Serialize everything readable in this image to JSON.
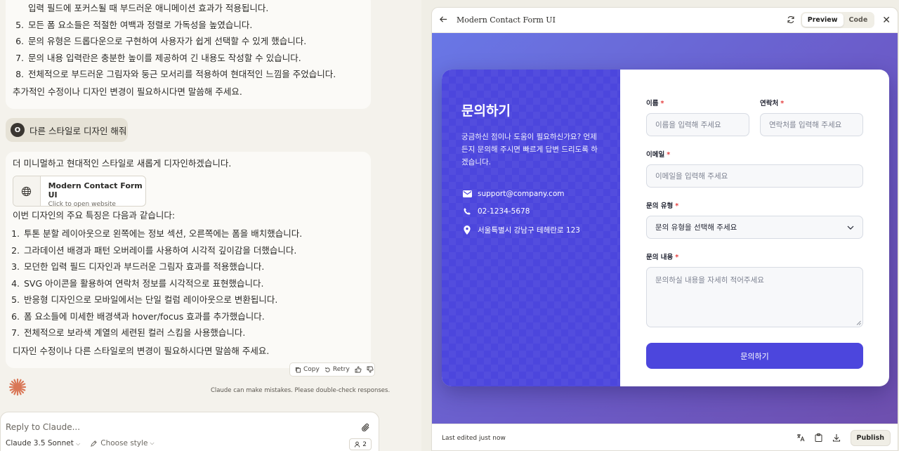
{
  "chat": {
    "top_list": [
      {
        "num": "",
        "text": "입력 필드에 포커스될 때 부드러운 애니메이션 효과가 적용됩니다."
      },
      {
        "num": "5.",
        "text": "모든 폼 요소들은 적절한 여백과 정렬로 가독성을 높였습니다."
      },
      {
        "num": "6.",
        "text": "문의 유형은 드롭다운으로 구현하여 사용자가 쉽게 선택할 수 있게 했습니다."
      },
      {
        "num": "7.",
        "text": "문의 내용 입력란은 충분한 높이를 제공하여 긴 내용도 작성할 수 있습니다."
      },
      {
        "num": "8.",
        "text": "전체적으로 부드러운 그림자와 둥근 모서리를 적용하여 현대적인 느낌을 주었습니다."
      }
    ],
    "top_closing": "추가적인 수정이나 디자인 변경이 필요하시다면 말씀해 주세요.",
    "user_initial": "O",
    "user_message": "다른 스타일로 디자인 해줘",
    "reply_intro": "더 미니멀하고 현대적인 스타일로 새롭게 디자인하겠습니다.",
    "artifact_title": "Modern Contact Form UI",
    "artifact_sub": "Click to open website",
    "features_intro": "이번 디자인의 주요 특징은 다음과 같습니다:",
    "features": [
      {
        "num": "1.",
        "text": "투톤 분할 레이아웃으로 왼쪽에는 정보 섹션, 오른쪽에는 폼을 배치했습니다."
      },
      {
        "num": "2.",
        "text": "그라데이션 배경과 패턴 오버레이를 사용하여 시각적 깊이감을 더했습니다."
      },
      {
        "num": "3.",
        "text": "모던한 입력 필드 디자인과 부드러운 그림자 효과를 적용했습니다."
      },
      {
        "num": "4.",
        "text": "SVG 아이콘을 활용하여 연락처 정보를 시각적으로 표현했습니다."
      },
      {
        "num": "5.",
        "text": "반응형 디자인으로 모바일에서는 단일 컬럼 레이아웃으로 변환됩니다."
      },
      {
        "num": "6.",
        "text": "폼 요소들에 미세한 배경색과 hover/focus 효과를 추가했습니다."
      },
      {
        "num": "7.",
        "text": "전체적으로 보라색 계열의 세련된 컬러 스킴을 사용했습니다."
      }
    ],
    "closing": "디자인 수정이나 다른 스타일로의 변경이 필요하시다면 말씀해 주세요.",
    "copy_label": "Copy",
    "retry_label": "Retry",
    "disclaimer": "Claude can make mistakes. Please double-check responses.",
    "reply_placeholder": "Reply to Claude...",
    "model_label": "Claude 3.5 Sonnet",
    "style_label": "Choose style",
    "counter": "2"
  },
  "pane": {
    "title": "Modern Contact Form UI",
    "preview_label": "Preview",
    "code_label": "Code",
    "last_edited": "Last edited just now",
    "publish_label": "Publish"
  },
  "form": {
    "heading": "문의하기",
    "description": "궁금하신 점이나 도움이 필요하신가요? 언제든지 문의해 주시면 빠르게 답변 드리도록 하겠습니다.",
    "email": "support@company.com",
    "phone": "02-1234-5678",
    "address": "서울특별시 강남구 테헤란로 123",
    "name_label": "이름",
    "name_placeholder": "이름을 입력해 주세요",
    "contact_label": "연락처",
    "contact_placeholder": "연락처를 입력해 주세요",
    "email_label": "이메일",
    "email_placeholder": "이메일을 입력해 주세요",
    "type_label": "문의 유형",
    "type_value": "문의 유형을 선택해 주세요",
    "content_label": "문의 내용",
    "content_placeholder": "문의하실 내용을 자세히 적어주세요",
    "required_mark": "*",
    "submit_label": "문의하기"
  },
  "colors": {
    "accent": "#4c46dd",
    "gradient_start": "#6977e6",
    "gradient_end": "#6e4fae",
    "required": "#e53e3e",
    "claude_orange": "#d97757"
  }
}
